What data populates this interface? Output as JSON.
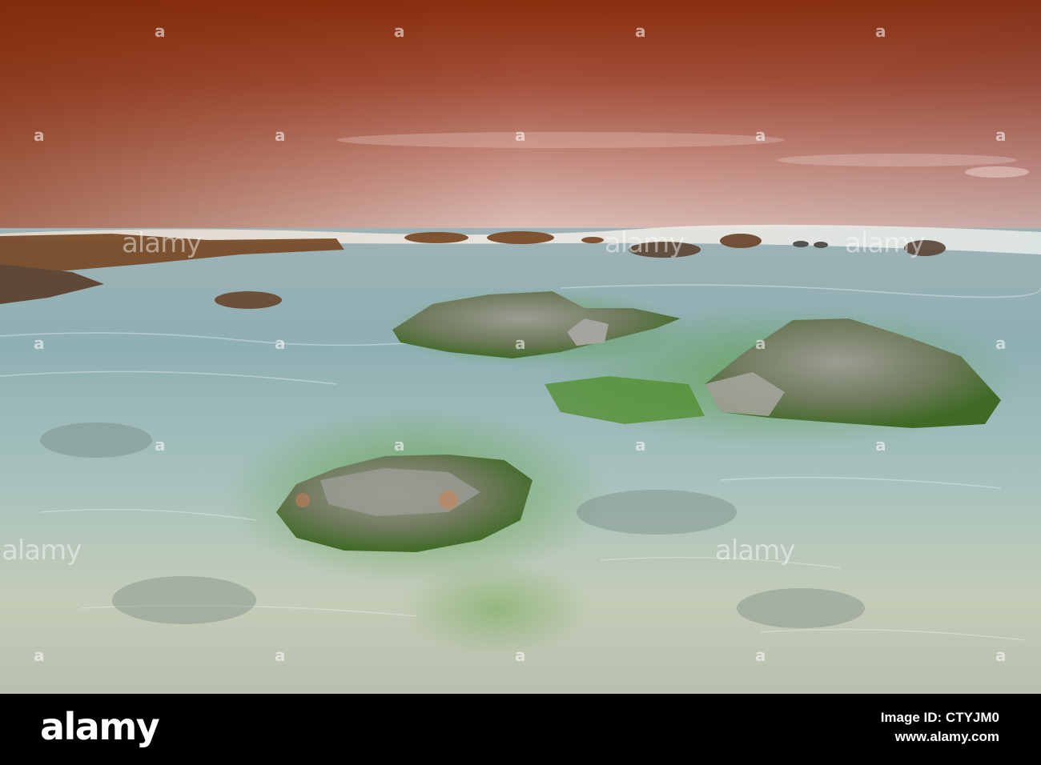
{
  "image": {
    "description_colors": {
      "sky_top": "#8a2e0e",
      "sky_mid": "#b4675a",
      "sky_horizon": "#dcb8b2",
      "water_far": "#9fb6bd",
      "water_near": "#c8d2c4",
      "algae": "#4f9a2c",
      "rock": "#8c8c84"
    }
  },
  "watermark": {
    "word": "alamy",
    "mark": "a"
  },
  "footer": {
    "brand": "alamy",
    "image_id_line": "Image ID: CTYJM0",
    "site_line": "www.alamy.com"
  }
}
